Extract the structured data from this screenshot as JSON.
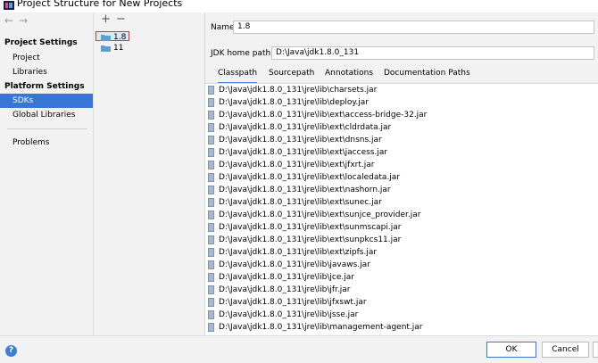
{
  "window": {
    "title": "Project Structure for New Projects"
  },
  "nav": {
    "back": "←",
    "forward": "→",
    "project_settings": "Project Settings",
    "project": "Project",
    "libraries": "Libraries",
    "platform_settings": "Platform Settings",
    "sdks": "SDKs",
    "global_libraries": "Global Libraries",
    "problems": "Problems"
  },
  "sdk_list": {
    "add": "+",
    "remove": "−",
    "items": [
      "1.8",
      "11"
    ]
  },
  "detail": {
    "name_label": "Name:",
    "name_value": "1.8",
    "home_label": "JDK home path:",
    "home_value": "D:\\Java\\jdk1.8.0_131",
    "tabs": [
      "Classpath",
      "Sourcepath",
      "Annotations",
      "Documentation Paths"
    ],
    "classpath": [
      "D:\\Java\\jdk1.8.0_131\\jre\\lib\\charsets.jar",
      "D:\\Java\\jdk1.8.0_131\\jre\\lib\\deploy.jar",
      "D:\\Java\\jdk1.8.0_131\\jre\\lib\\ext\\access-bridge-32.jar",
      "D:\\Java\\jdk1.8.0_131\\jre\\lib\\ext\\cldrdata.jar",
      "D:\\Java\\jdk1.8.0_131\\jre\\lib\\ext\\dnsns.jar",
      "D:\\Java\\jdk1.8.0_131\\jre\\lib\\ext\\jaccess.jar",
      "D:\\Java\\jdk1.8.0_131\\jre\\lib\\ext\\jfxrt.jar",
      "D:\\Java\\jdk1.8.0_131\\jre\\lib\\ext\\localedata.jar",
      "D:\\Java\\jdk1.8.0_131\\jre\\lib\\ext\\nashorn.jar",
      "D:\\Java\\jdk1.8.0_131\\jre\\lib\\ext\\sunec.jar",
      "D:\\Java\\jdk1.8.0_131\\jre\\lib\\ext\\sunjce_provider.jar",
      "D:\\Java\\jdk1.8.0_131\\jre\\lib\\ext\\sunmscapi.jar",
      "D:\\Java\\jdk1.8.0_131\\jre\\lib\\ext\\sunpkcs11.jar",
      "D:\\Java\\jdk1.8.0_131\\jre\\lib\\ext\\zipfs.jar",
      "D:\\Java\\jdk1.8.0_131\\jre\\lib\\javaws.jar",
      "D:\\Java\\jdk1.8.0_131\\jre\\lib\\jce.jar",
      "D:\\Java\\jdk1.8.0_131\\jre\\lib\\jfr.jar",
      "D:\\Java\\jdk1.8.0_131\\jre\\lib\\jfxswt.jar",
      "D:\\Java\\jdk1.8.0_131\\jre\\lib\\jsse.jar",
      "D:\\Java\\jdk1.8.0_131\\jre\\lib\\management-agent.jar"
    ]
  },
  "footer": {
    "help": "?",
    "ok": "OK",
    "cancel": "Cancel"
  },
  "colors": {
    "accent": "#3875d7",
    "selection_outline": "#e83030",
    "help": "#3d7ed8"
  }
}
